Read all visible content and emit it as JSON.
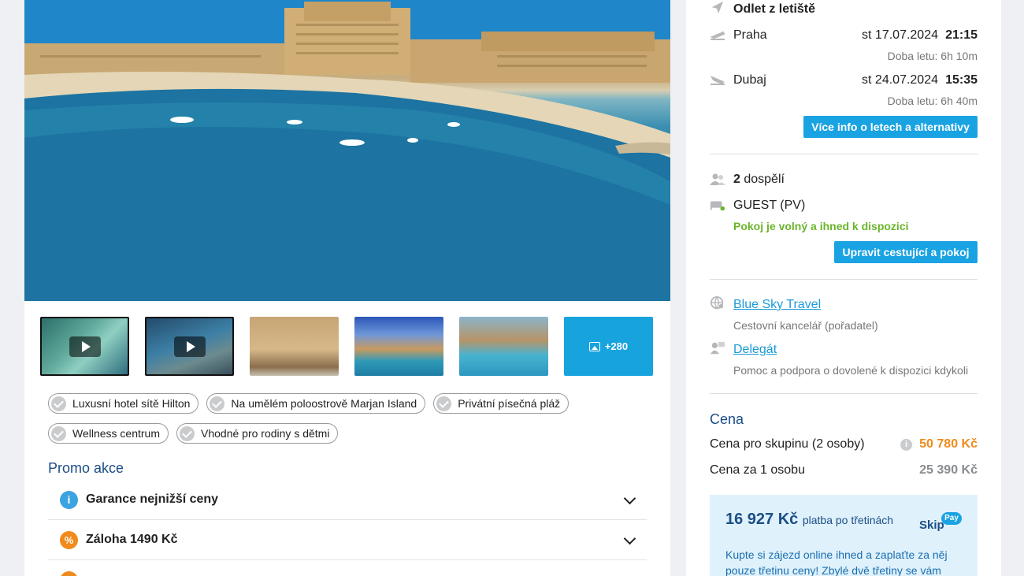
{
  "gallery": {
    "more_count": "+280"
  },
  "tags": [
    "Luxusní hotel sítě Hilton",
    "Na umělém poloostrově Marjan Island",
    "Privátní písečná pláž",
    "Wellness centrum",
    "Vhodné pro rodiny s dětmi"
  ],
  "promo": {
    "title": "Promo akce",
    "items": [
      {
        "icon": "info-icon",
        "label": "Garance nejnižší ceny"
      },
      {
        "icon": "percent-icon",
        "label": "Záloha 1490 Kč"
      }
    ]
  },
  "flights": {
    "departure_label": "Odlet z letiště",
    "outbound": {
      "city": "Praha",
      "date": "st 17.07.2024",
      "time": "21:15",
      "duration": "Doba letu: 6h 10m"
    },
    "return": {
      "city": "Dubaj",
      "date": "st 24.07.2024",
      "time": "15:35",
      "duration": "Doba letu: 6h 40m"
    },
    "more_button": "Více info o letech a alternativy"
  },
  "travelers": {
    "count": "2",
    "count_label": "dospělí",
    "room": "GUEST (PV)",
    "availability": "Pokoj je volný a ihned k dispozici",
    "edit_button": "Upravit cestující a pokoj"
  },
  "organizer": {
    "name": "Blue Sky Travel",
    "description": "Cestovní kancelář (pořadatel)",
    "delegate": "Delegát",
    "delegate_description": "Pomoc a podpora o dovolené k dispozici kdykoli"
  },
  "price": {
    "title": "Cena",
    "group_label": "Cena pro skupinu (2 osoby)",
    "group_value": "50 780 Kč",
    "per_person_label": "Cena za 1 osobu",
    "per_person_value": "25 390 Kč"
  },
  "skippay": {
    "amount": "16 927 Kč",
    "amount_suffix": "platba po třetinách",
    "logo_text": "Skip",
    "logo_badge": "Pay",
    "description": "Kupte si zájezd online ihned a zaplaťte za něj pouze třetinu ceny! Zbylé dvě třetiny se vám"
  },
  "colors": {
    "accent": "#1aa3e2",
    "navy": "#1b4e86",
    "orange": "#f08a1c",
    "green": "#6ab52a"
  }
}
